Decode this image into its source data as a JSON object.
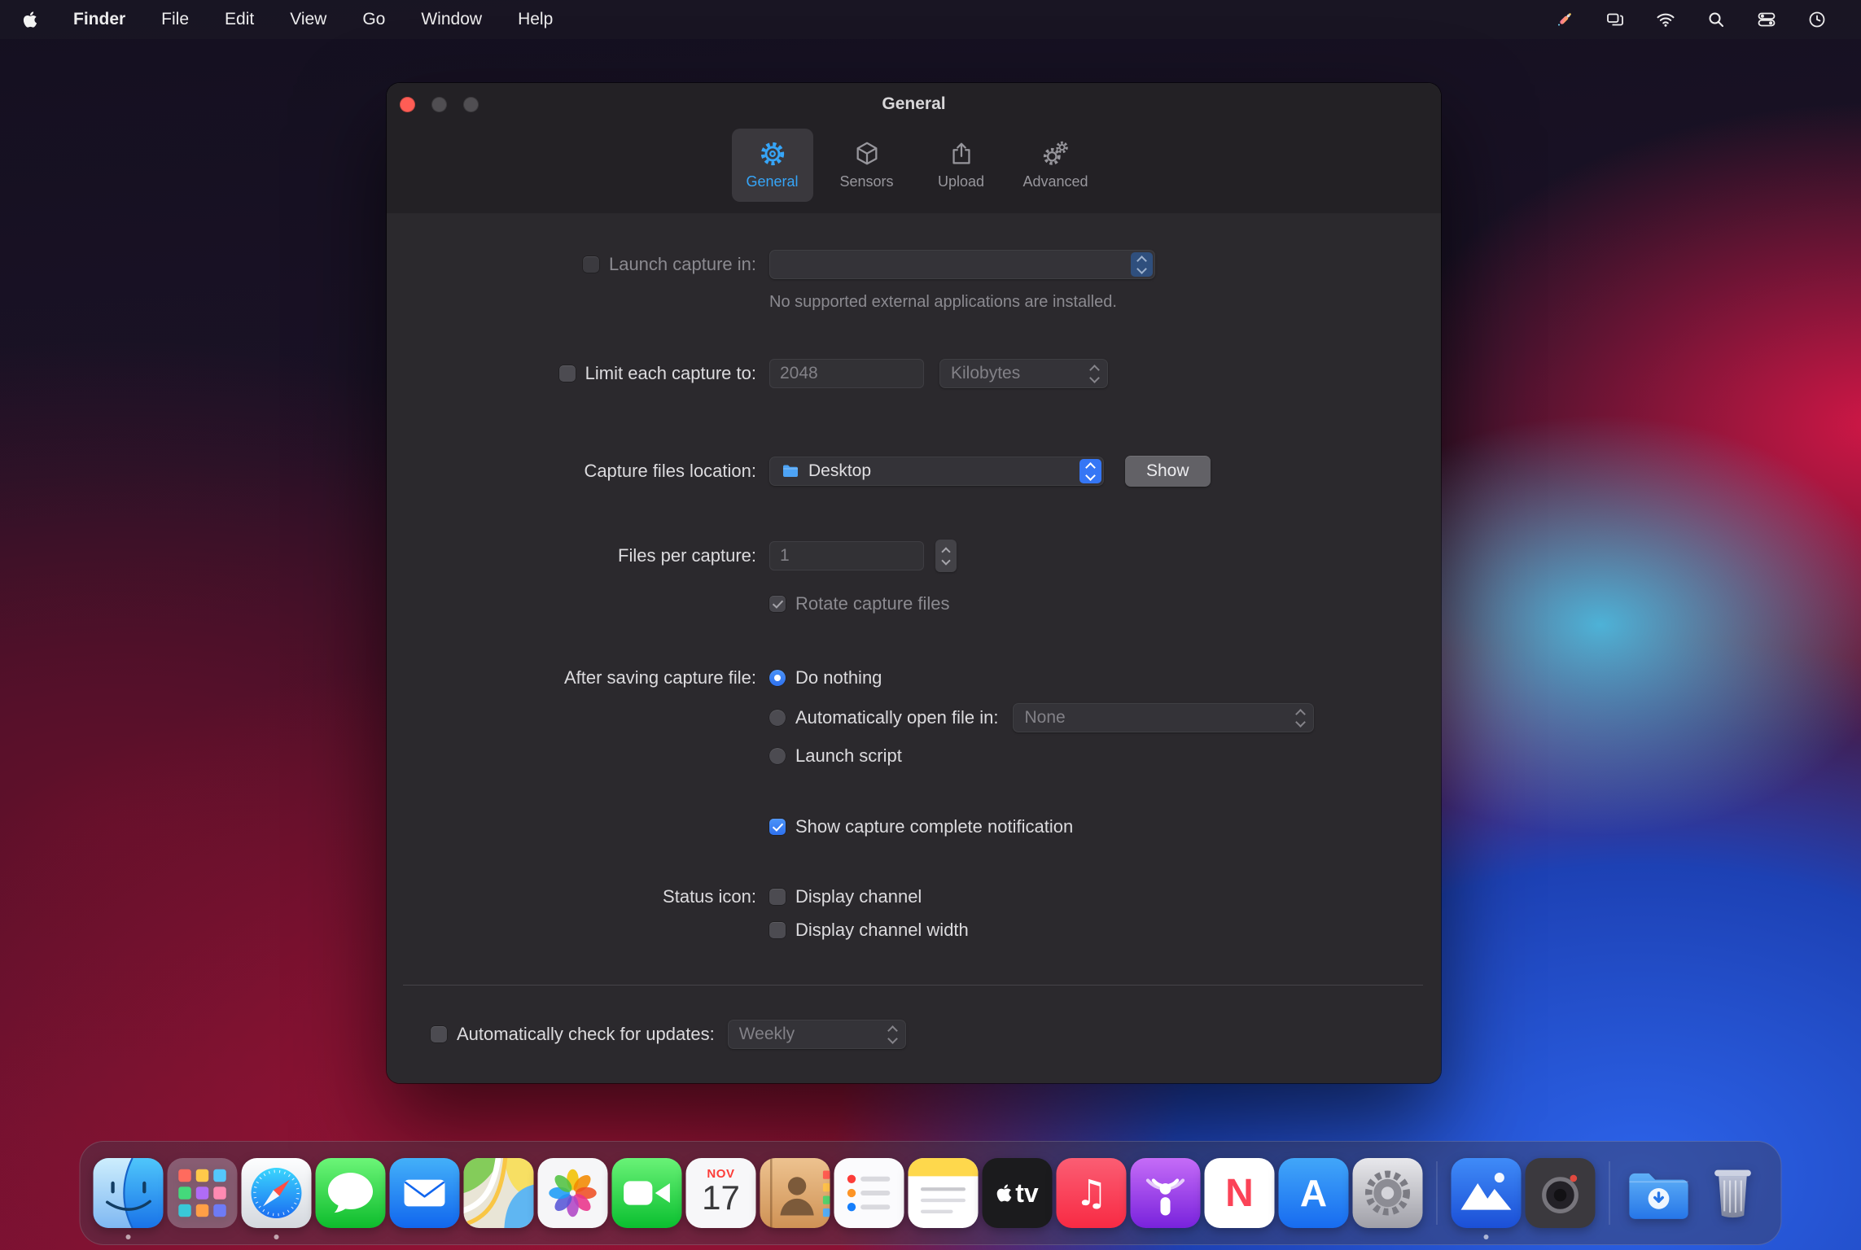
{
  "menu_bar": {
    "app_name": "Finder",
    "menus": [
      "File",
      "Edit",
      "View",
      "Go",
      "Window",
      "Help"
    ],
    "status_icons": [
      "tools-icon",
      "displays-icon",
      "wifi-icon",
      "search-icon",
      "control-center-icon",
      "clock-icon"
    ]
  },
  "window": {
    "title": "General",
    "tabs": [
      {
        "label": "General",
        "selected": true
      },
      {
        "label": "Sensors",
        "selected": false
      },
      {
        "label": "Upload",
        "selected": false
      },
      {
        "label": "Advanced",
        "selected": false
      }
    ],
    "launch_capture": {
      "label": "Launch capture in:",
      "checked": false,
      "enabled": false,
      "value": "",
      "note": "No supported external applications are installed."
    },
    "limit_capture": {
      "label": "Limit each capture to:",
      "checked": false,
      "size_value": "2048",
      "unit_value": "Kilobytes"
    },
    "capture_location": {
      "label": "Capture files location:",
      "value": "Desktop",
      "show_button": "Show"
    },
    "files_per_capture": {
      "label": "Files per capture:",
      "value": "1"
    },
    "rotate_files": {
      "label": "Rotate capture files",
      "checked": true,
      "enabled": false
    },
    "after_saving": {
      "label": "After saving capture file:",
      "options": [
        {
          "label": "Do nothing",
          "selected": true
        },
        {
          "label": "Automatically open file in:",
          "selected": false
        },
        {
          "label": "Launch script",
          "selected": false
        }
      ],
      "open_file_value": "None"
    },
    "notification": {
      "label": "Show capture complete notification",
      "checked": true
    },
    "status_icon": {
      "label": "Status icon:",
      "options": [
        {
          "label": "Display channel",
          "checked": false
        },
        {
          "label": "Display channel width",
          "checked": false
        }
      ]
    },
    "updates": {
      "label": "Automatically check for updates:",
      "checked": false,
      "value": "Weekly"
    }
  },
  "dock": {
    "items": [
      "finder",
      "launchpad",
      "safari",
      "messages",
      "mail",
      "maps",
      "photos",
      "facetime",
      "calendar",
      "contacts",
      "reminders",
      "notes",
      "apple-tv",
      "music",
      "podcasts",
      "news",
      "app-store",
      "system-preferences",
      "capture-app",
      "utility-app",
      "downloads",
      "trash"
    ],
    "running": [
      "finder",
      "safari",
      "capture-app"
    ],
    "calendar": {
      "month": "NOV",
      "day": "17"
    },
    "glyphs": {
      "tv": "tv",
      "music": "♫",
      "news": "N",
      "app_store": "A"
    }
  },
  "colors": {
    "accent_blue": "#3576f5",
    "selected_tab_blue": "#36a5f8",
    "window_bg": "#2b292d",
    "close_button_red": "#ff5d55"
  }
}
